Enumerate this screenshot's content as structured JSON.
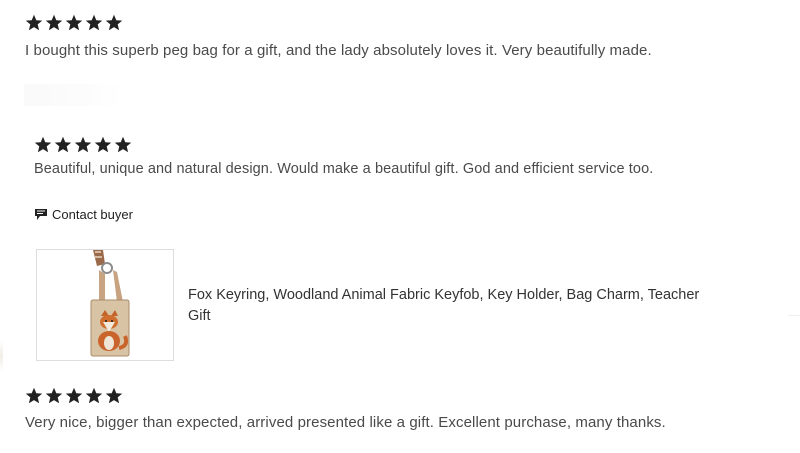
{
  "reviews": [
    {
      "rating": 5,
      "text": "I bought this superb peg bag for a gift, and the lady absolutely loves it. Very beautifully made."
    },
    {
      "rating": 5,
      "text": "Beautiful, unique and natural design. Would make a beautiful gift. God and efficient service too.",
      "contact_label": "Contact buyer",
      "product": {
        "title": "Fox Keyring, Woodland Animal Fabric Keyfob, Key Holder, Bag Charm, Teacher Gift"
      }
    },
    {
      "rating": 5,
      "text": "Very nice, bigger than expected, arrived presented like a gift. Excellent purchase, many thanks."
    }
  ],
  "colors": {
    "star": "#222222",
    "text": "#4a4a4a"
  },
  "icons": {
    "star": "star-icon",
    "contact": "message-flag-icon"
  }
}
